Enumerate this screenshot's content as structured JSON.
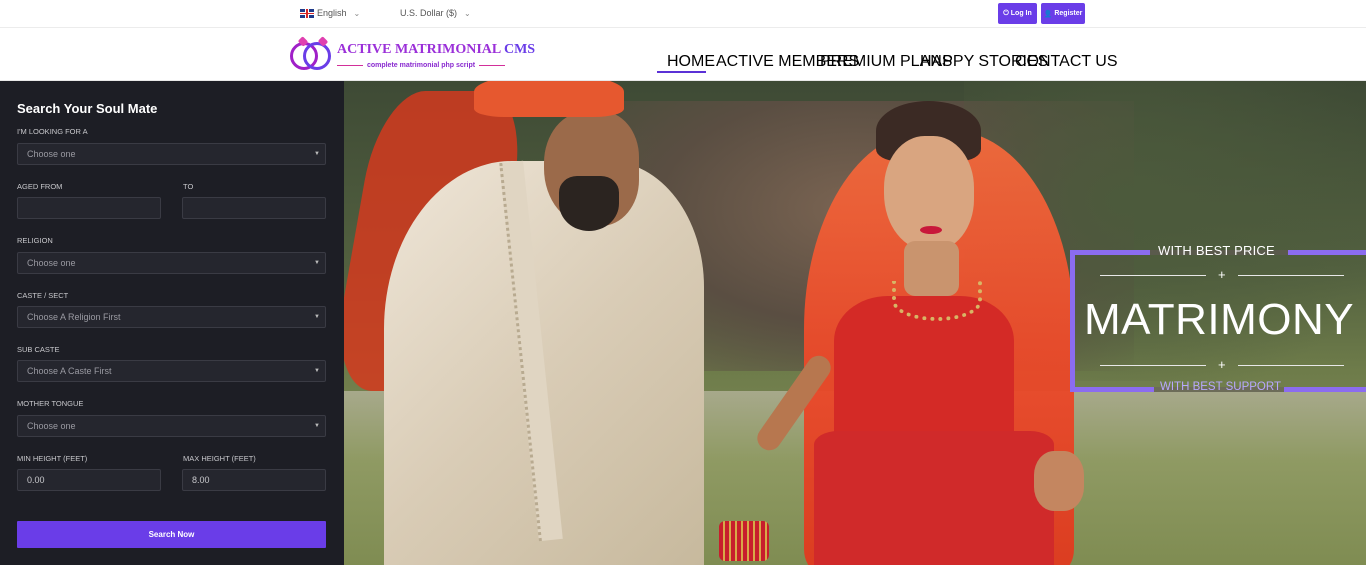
{
  "topbar": {
    "language": "English",
    "currency": "U.S. Dollar ($)",
    "login_label": "Log In",
    "register_label": "Register"
  },
  "logo": {
    "title": "ACTIVE MATRIMONIAL",
    "title_accent": "CMS",
    "tagline": "complete matrimonial php script"
  },
  "nav": {
    "items": [
      {
        "label": "HOME",
        "active": true
      },
      {
        "label": "ACTIVE MEMBERS"
      },
      {
        "label": "PREMIUM PLANS"
      },
      {
        "label": "HAPPY STORIES"
      },
      {
        "label": "CONTACT US"
      }
    ]
  },
  "search": {
    "title": "Search Your Soul Mate",
    "looking_for_label": "I'M LOOKING FOR A",
    "looking_for_value": "Choose one",
    "aged_from_label": "AGED FROM",
    "aged_from_value": "",
    "to_label": "TO",
    "to_value": "",
    "religion_label": "RELIGION",
    "religion_value": "Choose one",
    "caste_label": "CASTE / SECT",
    "caste_value": "Choose A Religion First",
    "sub_caste_label": "SUB CASTE",
    "sub_caste_value": "Choose A Caste First",
    "mother_tongue_label": "MOTHER TONGUE",
    "mother_tongue_value": "Choose one",
    "min_height_label": "MIN HEIGHT (FEET)",
    "min_height_value": "0.00",
    "max_height_label": "MAX HEIGHT (FEET)",
    "max_height_value": "8.00",
    "button_label": "Search Now"
  },
  "promo": {
    "top": "WITH BEST PRICE",
    "main": "MATRIMONY",
    "bottom": "WITH BEST SUPPORT",
    "plus": "+"
  },
  "colors": {
    "brand": "#6a3de8",
    "nav_text": "#5b31d6",
    "sidebar_bg": "#1d1e25"
  }
}
